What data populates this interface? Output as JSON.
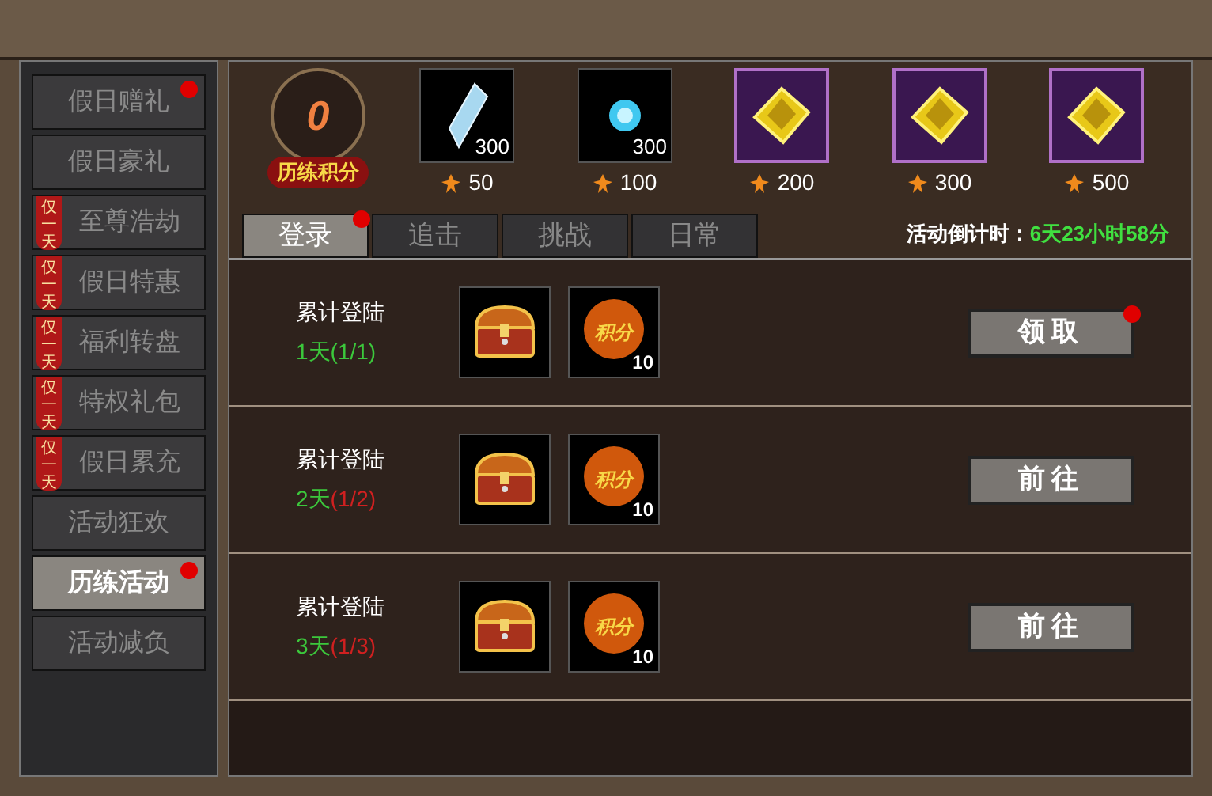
{
  "sidebar": {
    "items": [
      {
        "label": "假日赠礼",
        "limited": false,
        "selected": false,
        "dot": true
      },
      {
        "label": "假日豪礼",
        "limited": false,
        "selected": false,
        "dot": false
      },
      {
        "label": "至尊浩劫",
        "limited": true,
        "badge": "仅一天",
        "selected": false,
        "dot": false
      },
      {
        "label": "假日特惠",
        "limited": true,
        "badge": "仅一天",
        "selected": false,
        "dot": false
      },
      {
        "label": "福利转盘",
        "limited": true,
        "badge": "仅一天",
        "selected": false,
        "dot": false
      },
      {
        "label": "特权礼包",
        "limited": true,
        "badge": "仅一天",
        "selected": false,
        "dot": false
      },
      {
        "label": "假日累充",
        "limited": true,
        "badge": "仅一天",
        "selected": false,
        "dot": false
      },
      {
        "label": "活动狂欢",
        "limited": false,
        "selected": false,
        "dot": false
      },
      {
        "label": "历练活动",
        "limited": false,
        "selected": true,
        "dot": true
      },
      {
        "label": "活动减负",
        "limited": false,
        "selected": false,
        "dot": false
      }
    ]
  },
  "points": {
    "value": "0",
    "label": "历练积分"
  },
  "rewards": [
    {
      "kind": "crystal",
      "count": "300",
      "cost": "50"
    },
    {
      "kind": "orb",
      "count": "300",
      "cost": "100"
    },
    {
      "kind": "gem",
      "cost": "200"
    },
    {
      "kind": "gem",
      "cost": "300"
    },
    {
      "kind": "gem",
      "cost": "500"
    }
  ],
  "tabs": [
    {
      "label": "登录",
      "selected": true,
      "dot": true
    },
    {
      "label": "追击",
      "selected": false,
      "dot": false
    },
    {
      "label": "挑战",
      "selected": false,
      "dot": false
    },
    {
      "label": "日常",
      "selected": false,
      "dot": false
    }
  ],
  "countdown": {
    "label": "活动倒计时：",
    "value": "6天23小时58分"
  },
  "tasks": [
    {
      "title": "累计登陆",
      "day": "1天",
      "progress": "(1/1)",
      "complete": true,
      "points_icon_text": "积分",
      "points": "10",
      "button": "领取",
      "dot": true
    },
    {
      "title": "累计登陆",
      "day": "2天",
      "progress": "(1/2)",
      "complete": false,
      "points_icon_text": "积分",
      "points": "10",
      "button": "前往",
      "dot": false
    },
    {
      "title": "累计登陆",
      "day": "3天",
      "progress": "(1/3)",
      "complete": false,
      "points_icon_text": "积分",
      "points": "10",
      "button": "前往",
      "dot": false
    }
  ]
}
